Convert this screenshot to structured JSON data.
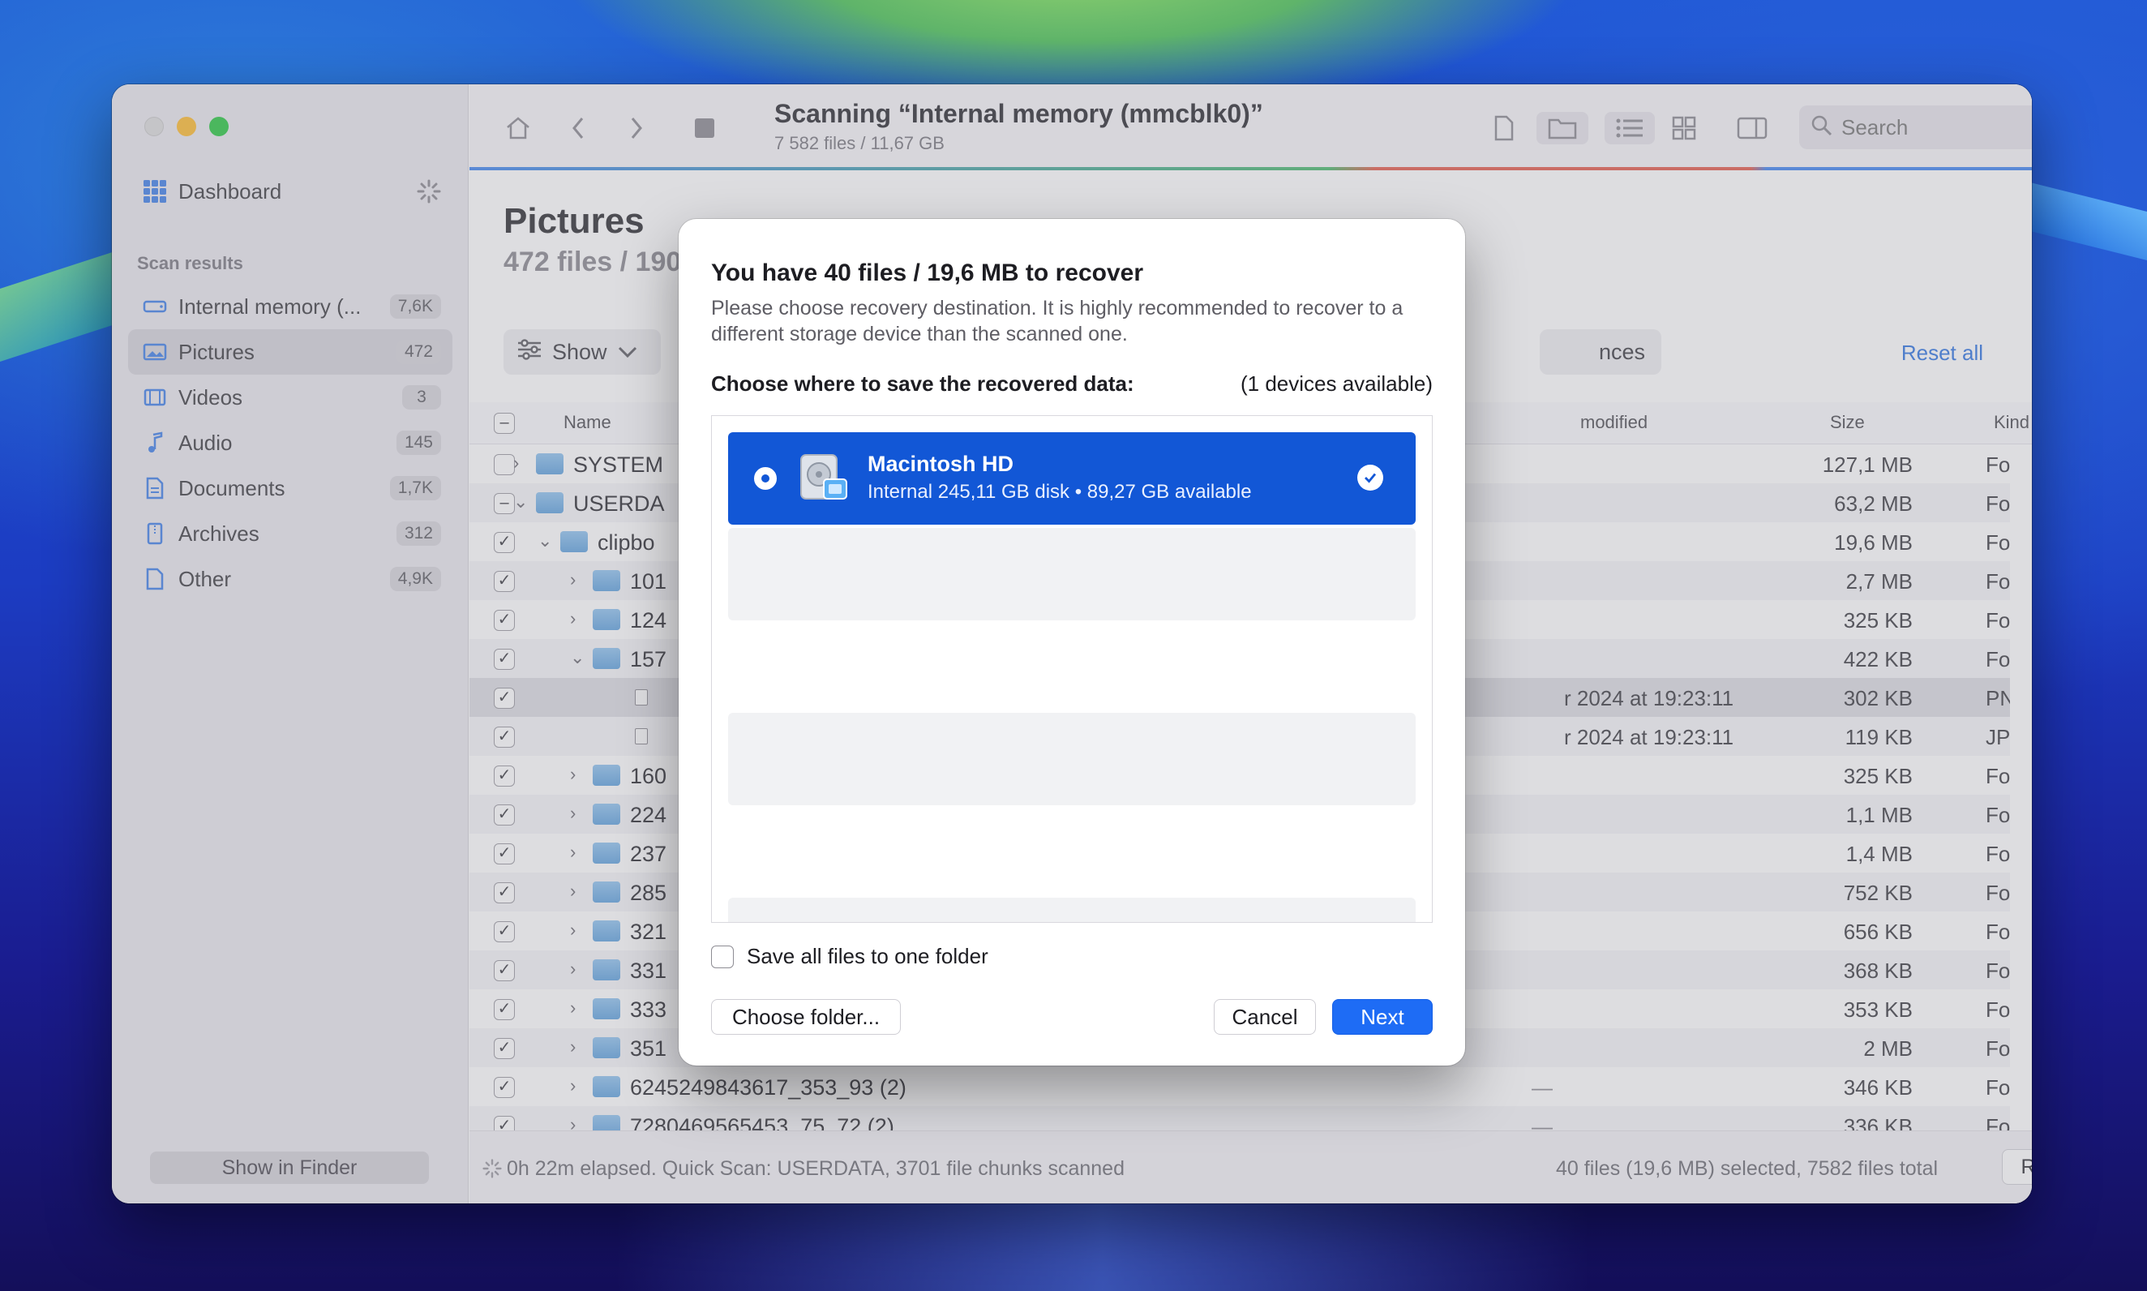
{
  "sidebar": {
    "dashboard_label": "Dashboard",
    "section_label": "Scan results",
    "items": [
      {
        "label": "Internal memory (...",
        "count": "7,6K",
        "icon": "drive-icon"
      },
      {
        "label": "Pictures",
        "count": "472",
        "icon": "image-icon"
      },
      {
        "label": "Videos",
        "count": "3",
        "icon": "film-icon"
      },
      {
        "label": "Audio",
        "count": "145",
        "icon": "music-note-icon"
      },
      {
        "label": "Documents",
        "count": "1,7K",
        "icon": "document-icon"
      },
      {
        "label": "Archives",
        "count": "312",
        "icon": "archive-icon"
      },
      {
        "label": "Other",
        "count": "4,9K",
        "icon": "file-icon"
      }
    ],
    "show_in_finder": "Show in Finder"
  },
  "toolbar": {
    "title": "Scanning “Internal memory (mmcblk0)”",
    "subtitle": "7 582 files / 11,67 GB",
    "search_placeholder": "Search"
  },
  "content": {
    "page_title": "Pictures",
    "page_subtitle": "472 files / 190",
    "show_label": "Show",
    "preferences_fragment": "nces",
    "reset_all": "Reset all",
    "columns": {
      "name": "Name",
      "modified": "modified",
      "size": "Size",
      "kind": "Kind"
    },
    "rows": [
      {
        "name": "SYSTEM",
        "date": "",
        "size": "127,1 MB",
        "kind": "Folder",
        "checked": "",
        "indent": 0,
        "chev": "›"
      },
      {
        "name": "USERDA",
        "date": "",
        "size": "63,2 MB",
        "kind": "Folder",
        "checked": "–",
        "indent": 0,
        "chev": "⌄"
      },
      {
        "name": "clipbo",
        "date": "",
        "size": "19,6 MB",
        "kind": "Folder",
        "checked": "✓",
        "indent": 1,
        "chev": "⌄"
      },
      {
        "name": "101",
        "date": "",
        "size": "2,7 MB",
        "kind": "Folder",
        "checked": "✓",
        "indent": 2,
        "chev": "›"
      },
      {
        "name": "124",
        "date": "",
        "size": "325 KB",
        "kind": "Folder",
        "checked": "✓",
        "indent": 2,
        "chev": "›"
      },
      {
        "name": "157",
        "date": "",
        "size": "422 KB",
        "kind": "Folder",
        "checked": "✓",
        "indent": 2,
        "chev": "⌄"
      },
      {
        "name": "",
        "date": "r 2024 at 19:23:11",
        "size": "302 KB",
        "kind": "PNG image",
        "checked": "✓",
        "indent": 3,
        "chev": ""
      },
      {
        "name": "",
        "date": "r 2024 at 19:23:11",
        "size": "119 KB",
        "kind": "JPEG ima...",
        "checked": "✓",
        "indent": 3,
        "chev": ""
      },
      {
        "name": "160",
        "date": "",
        "size": "325 KB",
        "kind": "Folder",
        "checked": "✓",
        "indent": 2,
        "chev": "›"
      },
      {
        "name": "224",
        "date": "",
        "size": "1,1 MB",
        "kind": "Folder",
        "checked": "✓",
        "indent": 2,
        "chev": "›"
      },
      {
        "name": "237",
        "date": "",
        "size": "1,4 MB",
        "kind": "Folder",
        "checked": "✓",
        "indent": 2,
        "chev": "›"
      },
      {
        "name": "285",
        "date": "",
        "size": "752 KB",
        "kind": "Folder",
        "checked": "✓",
        "indent": 2,
        "chev": "›"
      },
      {
        "name": "321",
        "date": "",
        "size": "656 KB",
        "kind": "Folder",
        "checked": "✓",
        "indent": 2,
        "chev": "›"
      },
      {
        "name": "331",
        "date": "",
        "size": "368 KB",
        "kind": "Folder",
        "checked": "✓",
        "indent": 2,
        "chev": "›"
      },
      {
        "name": "333",
        "date": "",
        "size": "353 KB",
        "kind": "Folder",
        "checked": "✓",
        "indent": 2,
        "chev": "›"
      },
      {
        "name": "351",
        "date": "",
        "size": "2 MB",
        "kind": "Folder",
        "checked": "✓",
        "indent": 2,
        "chev": "›"
      },
      {
        "name": "6245249843617_353_93 (2)",
        "date": "—",
        "size": "346 KB",
        "kind": "Folder",
        "checked": "✓",
        "indent": 2,
        "chev": "›"
      },
      {
        "name": "7280469565453_75_72 (2)",
        "date": "—",
        "size": "336 KB",
        "kind": "Folder",
        "checked": "✓",
        "indent": 2,
        "chev": "›"
      }
    ]
  },
  "status": {
    "left": "0h 22m elapsed. Quick Scan: USERDATA, 3701 file chunks scanned",
    "right": "40 files (19,6 MB) selected, 7582 files total",
    "recover": "Recover"
  },
  "modal": {
    "title": "You have 40 files / 19,6 MB to recover",
    "description": "Please choose recovery destination. It is highly recommended to recover to a different storage device than the scanned one.",
    "choose_label": "Choose where to save the recovered data:",
    "devices_available": "(1 devices available)",
    "device": {
      "name": "Macintosh HD",
      "info": "Internal 245,11 GB disk • 89,27 GB available"
    },
    "save_one_folder": "Save all files to one folder",
    "choose_folder": "Choose folder...",
    "cancel": "Cancel",
    "next": "Next"
  },
  "colors": {
    "accent": "#1257d6",
    "next_button": "#1e6cf5"
  }
}
